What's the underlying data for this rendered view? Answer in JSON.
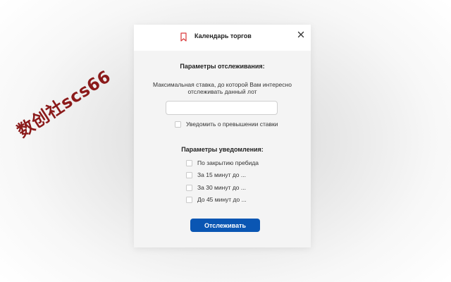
{
  "watermark": {
    "text": "数创社scs66"
  },
  "dialog": {
    "title": "Календарь торгов",
    "tracking": {
      "section_title": "Параметры отслеживания:",
      "description_line1": "Максимальная ставка, до которой Вам интересно",
      "description_line2": "отслеживать данный лот",
      "bid_input_value": "",
      "notify_exceed_label": "Уведомить о превышении ставки"
    },
    "notification": {
      "section_title": "Параметры уведомления:",
      "options": [
        {
          "label": "По закрытию пребида",
          "checked": false
        },
        {
          "label": "За 15 минут  до ...",
          "checked": false
        },
        {
          "label": "За 30 минут до ...",
          "checked": false
        },
        {
          "label": "До 45 минут до ...",
          "checked": false
        }
      ]
    },
    "track_button_label": "Отслеживать"
  },
  "colors": {
    "accent": "#0a56b3",
    "bookmark_icon": "#d9383a",
    "watermark": "#8b1a1a"
  },
  "icons": {
    "header_icon": "bookmark-icon",
    "close": "close-icon"
  }
}
